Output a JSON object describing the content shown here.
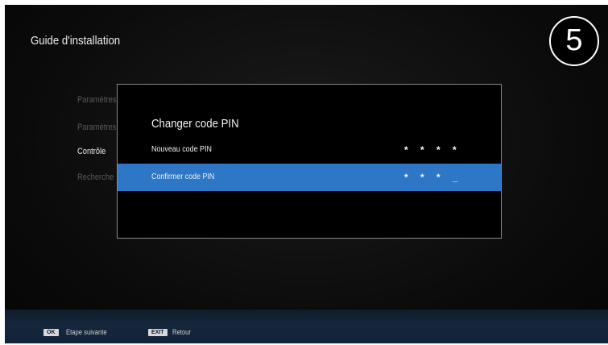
{
  "header": {
    "title": "Guide d'installation"
  },
  "step_badge": {
    "number": "5"
  },
  "steps": [
    {
      "label": "Paramètres",
      "state": "dim"
    },
    {
      "label": "Paramètres",
      "state": "dim"
    },
    {
      "label": "Contrôle",
      "state": "active"
    },
    {
      "label": "Recherche",
      "state": "dim"
    }
  ],
  "dialog": {
    "title": "Changer code PIN",
    "rows": [
      {
        "label": "Nouveau code PIN",
        "value": "* * * *",
        "selected": false
      },
      {
        "label": "Confirmer code PIN",
        "value": "* * * _",
        "selected": true
      }
    ]
  },
  "footer": {
    "items": [
      {
        "key": "OK",
        "label": "Etape suivante"
      },
      {
        "key": "EXIT",
        "label": "Retour"
      }
    ]
  },
  "colors": {
    "selection": "#2e76c6",
    "footer_bg": "#14263c",
    "dialog_border": "#8a8a8a"
  }
}
